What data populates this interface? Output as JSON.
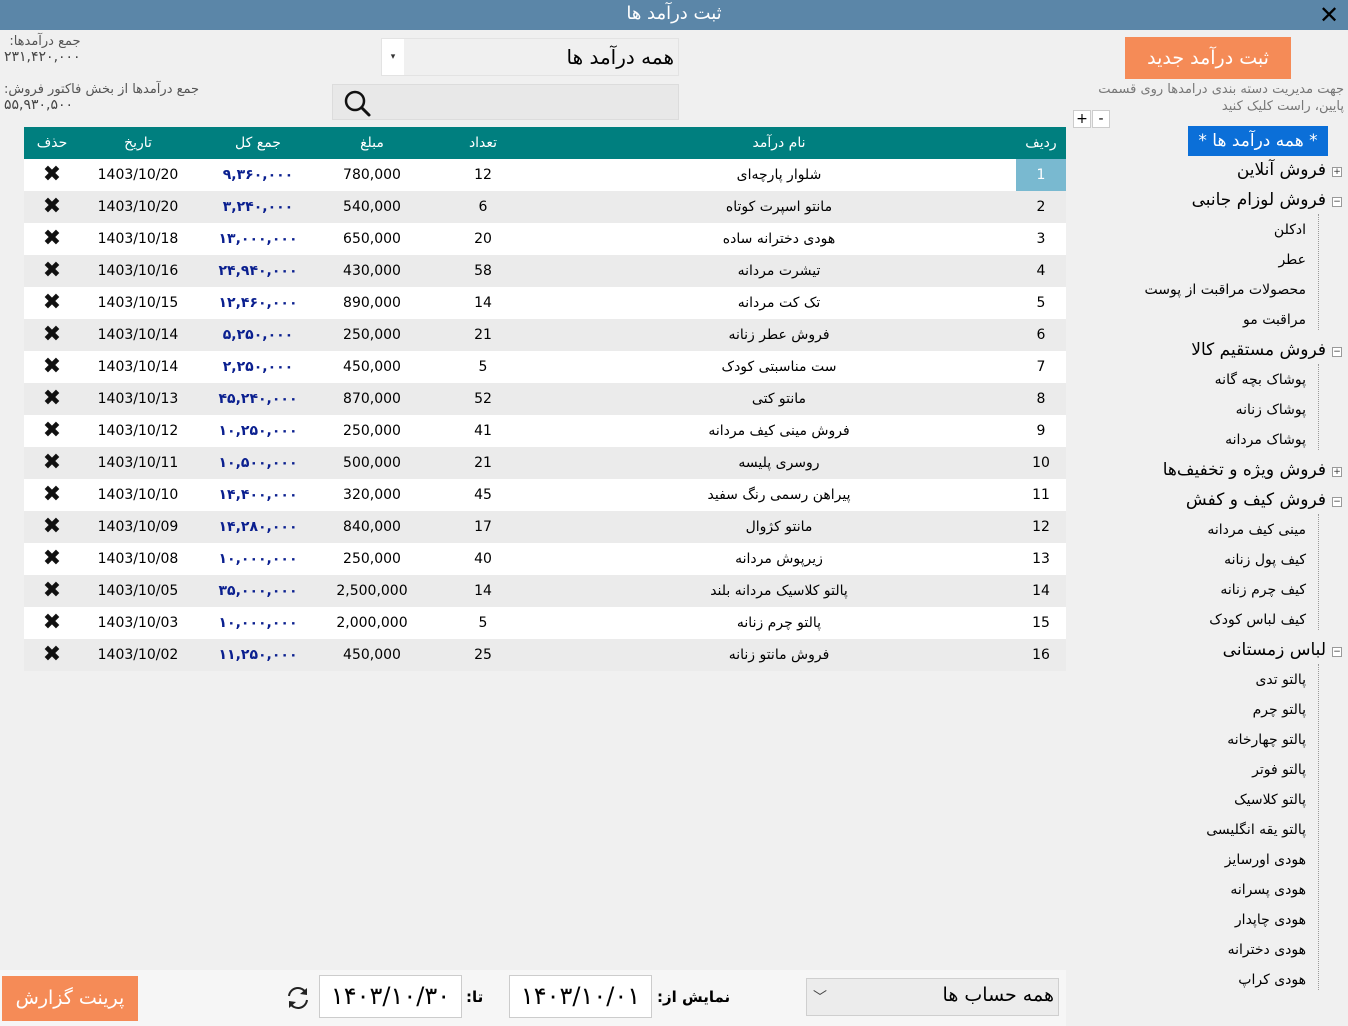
{
  "window": {
    "title": "ثبت درآمد ها",
    "close": "✕"
  },
  "totals": {
    "sum_label": "جمع درآمدها:",
    "sum_value": "۲۳۱,۴۲۰,۰۰۰",
    "invoice_label": "جمع درآمدها از بخش فاکتور فروش:",
    "invoice_value": "۵۵,۹۳۰,۵۰۰"
  },
  "filter": {
    "category_value": "همه درآمد ها",
    "arrow": "▾",
    "search_placeholder": ""
  },
  "actions": {
    "new_income": "ثبت درآمد جدید",
    "help": "جهت مدیریت دسته بندی درامدها روی قسمت پایین، راست کلیک کنید",
    "plus": "+",
    "minus": "-"
  },
  "grid": {
    "headers": {
      "idx": "ردیف",
      "name": "نام درآمد",
      "qty": "تعداد",
      "amount": "مبلغ",
      "total": "جمع کل",
      "date": "تاریخ",
      "del": "حذف"
    },
    "delete_glyph": "✖",
    "rows": [
      {
        "idx": "1",
        "name": "شلوار پارچه‌ای",
        "qty": "12",
        "amount": "780,000",
        "total": "۹,۳۶۰,۰۰۰",
        "date": "1403/10/20"
      },
      {
        "idx": "2",
        "name": "مانتو اسپرت کوتاه",
        "qty": "6",
        "amount": "540,000",
        "total": "۳,۲۴۰,۰۰۰",
        "date": "1403/10/20"
      },
      {
        "idx": "3",
        "name": "هودی دخترانه ساده",
        "qty": "20",
        "amount": "650,000",
        "total": "۱۳,۰۰۰,۰۰۰",
        "date": "1403/10/18"
      },
      {
        "idx": "4",
        "name": "تیشرت مردانه",
        "qty": "58",
        "amount": "430,000",
        "total": "۲۴,۹۴۰,۰۰۰",
        "date": "1403/10/16"
      },
      {
        "idx": "5",
        "name": "تک کت مردانه",
        "qty": "14",
        "amount": "890,000",
        "total": "۱۲,۴۶۰,۰۰۰",
        "date": "1403/10/15"
      },
      {
        "idx": "6",
        "name": "فروش عطر زنانه",
        "qty": "21",
        "amount": "250,000",
        "total": "۵,۲۵۰,۰۰۰",
        "date": "1403/10/14"
      },
      {
        "idx": "7",
        "name": "ست مناسبتی کودک",
        "qty": "5",
        "amount": "450,000",
        "total": "۲,۲۵۰,۰۰۰",
        "date": "1403/10/14"
      },
      {
        "idx": "8",
        "name": "مانتو کتی",
        "qty": "52",
        "amount": "870,000",
        "total": "۴۵,۲۴۰,۰۰۰",
        "date": "1403/10/13"
      },
      {
        "idx": "9",
        "name": "فروش مینی کیف مردانه",
        "qty": "41",
        "amount": "250,000",
        "total": "۱۰,۲۵۰,۰۰۰",
        "date": "1403/10/12"
      },
      {
        "idx": "10",
        "name": "روسری پلیسه",
        "qty": "21",
        "amount": "500,000",
        "total": "۱۰,۵۰۰,۰۰۰",
        "date": "1403/10/11"
      },
      {
        "idx": "11",
        "name": "پیراهن رسمی رنگ سفید",
        "qty": "45",
        "amount": "320,000",
        "total": "۱۴,۴۰۰,۰۰۰",
        "date": "1403/10/10"
      },
      {
        "idx": "12",
        "name": "مانتو کژوال",
        "qty": "17",
        "amount": "840,000",
        "total": "۱۴,۲۸۰,۰۰۰",
        "date": "1403/10/09"
      },
      {
        "idx": "13",
        "name": "زیرپوش مردانه",
        "qty": "40",
        "amount": "250,000",
        "total": "۱۰,۰۰۰,۰۰۰",
        "date": "1403/10/08"
      },
      {
        "idx": "14",
        "name": "پالتو کلاسیک مردانه بلند",
        "qty": "14",
        "amount": "2,500,000",
        "total": "۳۵,۰۰۰,۰۰۰",
        "date": "1403/10/05"
      },
      {
        "idx": "15",
        "name": "پالتو چرم زنانه",
        "qty": "5",
        "amount": "2,000,000",
        "total": "۱۰,۰۰۰,۰۰۰",
        "date": "1403/10/03"
      },
      {
        "idx": "16",
        "name": "فروش مانتو زنانه",
        "qty": "25",
        "amount": "450,000",
        "total": "۱۱,۲۵۰,۰۰۰",
        "date": "1403/10/02"
      }
    ]
  },
  "tree": {
    "root": "* همه درآمد ها *",
    "groups": [
      {
        "label": "فروش آنلاین",
        "box": "+",
        "children": []
      },
      {
        "label": "فروش لوزام جانبی",
        "box": "−",
        "children": [
          "ادکلن",
          "عطر",
          "محصولات مراقبت از پوست",
          "مراقبت مو"
        ]
      },
      {
        "label": "فروش مستقیم کالا",
        "box": "−",
        "children": [
          "پوشاک بچه گانه",
          "پوشاک زنانه",
          "پوشاک مردانه"
        ]
      },
      {
        "label": "فروش ویژه و تخفیف‌ها",
        "box": "+",
        "children": []
      },
      {
        "label": "فروش کیف و کفش",
        "box": "−",
        "children": [
          "مینی کیف مردانه",
          "کیف پول زنانه",
          "کیف چرم زنانه",
          "کیف لباس کودک"
        ]
      },
      {
        "label": "لباس زمستانی",
        "box": "−",
        "children": [
          "پالتو تدی",
          "پالتو چرم",
          "پالتو چهارخانه",
          "پالتو فوتر",
          "پالتو کلاسیک",
          "پالتو یقه انگلیسی",
          "هودی اورسایز",
          "هودی پسرانه",
          "هودی چاپدار",
          "هودی دخترانه",
          "هودی کراپ"
        ]
      }
    ]
  },
  "footer": {
    "print": "پرینت گزارش",
    "to_label": "تا:",
    "to_value": "۱۴۰۳/۱۰/۳۰",
    "from_label": "نمایش از:",
    "from_value": "۱۴۰۳/۱۰/۰۱",
    "accounts_value": "همه حساب ها",
    "arrow": "﹀"
  }
}
